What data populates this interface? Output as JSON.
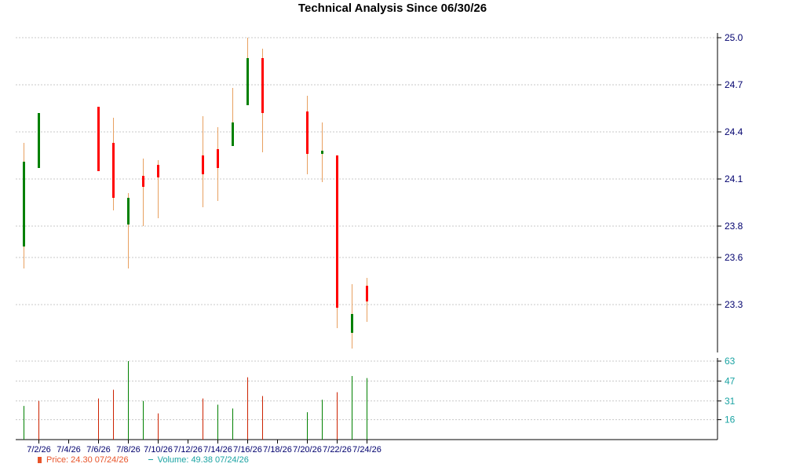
{
  "chart_data": [
    {
      "type": "candlestick",
      "title": "Technical Analysis Since 06/30/26",
      "ylim": [
        23.05,
        25.0
      ],
      "y_ticks": [
        23.3,
        23.6,
        23.8,
        24.1,
        24.4,
        24.7,
        25.0
      ],
      "y_tick_labels": [
        "23.3",
        "23.6",
        "23.8",
        "24.1",
        "24.4",
        "24.7",
        "25.0"
      ],
      "x_tick_labels": [
        "7/2/26",
        "7/4/26",
        "7/6/26",
        "7/8/26",
        "7/10/26",
        "7/12/26",
        "7/14/26",
        "7/16/26",
        "7/18/26",
        "7/20/26",
        "7/22/26",
        "7/24/26"
      ],
      "grid": true,
      "colors": {
        "up": "#008000",
        "down": "#ff0000",
        "wick": "#e8a060",
        "grid": "#c8c8c8",
        "axis": "#000000",
        "tick_text": "#00006e"
      },
      "candles": [
        {
          "date": "7/1/26",
          "open": 23.67,
          "high": 24.33,
          "low": 23.53,
          "close": 24.21
        },
        {
          "date": "7/2/26",
          "open": 24.17,
          "high": 24.52,
          "low": 24.17,
          "close": 24.52
        },
        {
          "date": "7/6/26",
          "open": 24.56,
          "high": 24.56,
          "low": 24.15,
          "close": 24.15
        },
        {
          "date": "7/7/26",
          "open": 24.33,
          "high": 24.49,
          "low": 23.9,
          "close": 23.98
        },
        {
          "date": "7/8/26",
          "open": 23.81,
          "high": 24.01,
          "low": 23.53,
          "close": 23.98
        },
        {
          "date": "7/9/26",
          "open": 24.12,
          "high": 24.23,
          "low": 23.8,
          "close": 24.05
        },
        {
          "date": "7/10/26",
          "open": 24.19,
          "high": 24.22,
          "low": 23.85,
          "close": 24.11
        },
        {
          "date": "7/13/26",
          "open": 24.25,
          "high": 24.5,
          "low": 23.92,
          "close": 24.13
        },
        {
          "date": "7/14/26",
          "open": 24.29,
          "high": 24.43,
          "low": 23.96,
          "close": 24.17
        },
        {
          "date": "7/15/26",
          "open": 24.31,
          "high": 24.68,
          "low": 24.31,
          "close": 24.46
        },
        {
          "date": "7/16/26",
          "open": 24.57,
          "high": 25.0,
          "low": 24.57,
          "close": 24.87
        },
        {
          "date": "7/17/26",
          "open": 24.87,
          "high": 24.93,
          "low": 24.27,
          "close": 24.52
        },
        {
          "date": "7/20/26",
          "open": 24.53,
          "high": 24.63,
          "low": 24.13,
          "close": 24.26
        },
        {
          "date": "7/21/26",
          "open": 24.26,
          "high": 24.46,
          "low": 24.08,
          "close": 24.28
        },
        {
          "date": "7/22/26",
          "open": 24.25,
          "high": 24.25,
          "low": 23.15,
          "close": 23.28
        },
        {
          "date": "7/23/26",
          "open": 23.12,
          "high": 23.43,
          "low": 23.02,
          "close": 23.24
        },
        {
          "date": "7/24/26",
          "open": 23.42,
          "high": 23.47,
          "low": 23.19,
          "close": 23.32
        }
      ]
    },
    {
      "type": "bar",
      "ylim": [
        0,
        63
      ],
      "y_ticks": [
        16,
        31,
        47,
        63
      ],
      "y_tick_labels": [
        "16",
        "31",
        "47",
        "63"
      ],
      "grid": true,
      "colors": {
        "up": "#008000",
        "down": "#cc2200"
      },
      "bars": [
        {
          "date": "7/1/26",
          "value": 27,
          "up": true
        },
        {
          "date": "7/2/26",
          "value": 31,
          "up": false
        },
        {
          "date": "7/6/26",
          "value": 33,
          "up": false
        },
        {
          "date": "7/7/26",
          "value": 40,
          "up": false
        },
        {
          "date": "7/8/26",
          "value": 63,
          "up": true
        },
        {
          "date": "7/9/26",
          "value": 31,
          "up": true
        },
        {
          "date": "7/10/26",
          "value": 21,
          "up": false
        },
        {
          "date": "7/13/26",
          "value": 33,
          "up": false
        },
        {
          "date": "7/14/26",
          "value": 28,
          "up": true
        },
        {
          "date": "7/15/26",
          "value": 25,
          "up": true
        },
        {
          "date": "7/16/26",
          "value": 50,
          "up": false
        },
        {
          "date": "7/17/26",
          "value": 35,
          "up": false
        },
        {
          "date": "7/20/26",
          "value": 22,
          "up": true
        },
        {
          "date": "7/21/26",
          "value": 32,
          "up": true
        },
        {
          "date": "7/22/26",
          "value": 38,
          "up": false
        },
        {
          "date": "7/23/26",
          "value": 51,
          "up": true
        },
        {
          "date": "7/24/26",
          "value": 49.38,
          "up": true
        }
      ]
    }
  ],
  "legend": {
    "price_label": "Price: 24.30  07/24/26",
    "volume_label": "Volume: 49.38  07/24/26",
    "price_color": "#e8542a",
    "volume_color": "#1aa3a3"
  }
}
